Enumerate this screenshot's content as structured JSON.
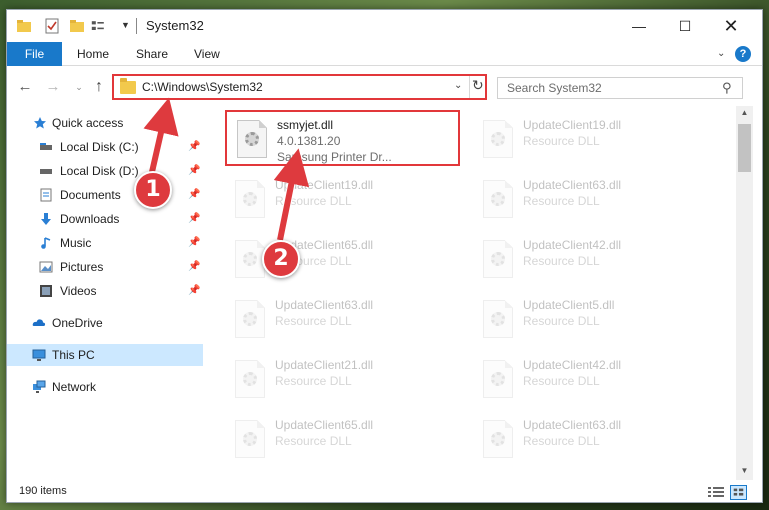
{
  "window": {
    "title": "System32",
    "min_glyph": "—",
    "max_glyph": "☐",
    "close_glyph": "✕"
  },
  "ribbon": {
    "tabs": [
      "File",
      "Home",
      "Share",
      "View"
    ],
    "help_glyph": "?",
    "chevron_glyph": "⌄"
  },
  "nav": {
    "back_glyph": "←",
    "forward_glyph": "→",
    "recent_glyph": "⌄",
    "up_glyph": "↑",
    "address": "C:\\Windows\\System32",
    "address_drop_glyph": "⌄",
    "refresh_glyph": "↻",
    "search_placeholder": "Search System32",
    "search_glyph": "⚲"
  },
  "sidebar": {
    "items": [
      {
        "label": "Quick access",
        "icon": "star-icon",
        "pinned": false
      },
      {
        "label": "Local Disk (C:)",
        "icon": "drive-icon",
        "pinned": true
      },
      {
        "label": "Local Disk (D:)",
        "icon": "drive-icon",
        "pinned": true
      },
      {
        "label": "Documents",
        "icon": "documents-icon",
        "pinned": true
      },
      {
        "label": "Downloads",
        "icon": "downloads-icon",
        "pinned": true
      },
      {
        "label": "Music",
        "icon": "music-icon",
        "pinned": true
      },
      {
        "label": "Pictures",
        "icon": "pictures-icon",
        "pinned": true
      },
      {
        "label": "Videos",
        "icon": "videos-icon",
        "pinned": true
      },
      {
        "label": "OneDrive",
        "icon": "onedrive-icon",
        "pinned": false
      },
      {
        "label": "This PC",
        "icon": "this-pc-icon",
        "pinned": false,
        "selected": true
      },
      {
        "label": "Network",
        "icon": "network-icon",
        "pinned": false
      }
    ],
    "pin_glyph": "📌"
  },
  "files": [
    {
      "name": "ssmyjet.dll",
      "line2": "4.0.1381.20",
      "line3": "Samsung Printer Dr..."
    },
    {
      "name": "UpdateClient19.dll",
      "line2": "Resource DLL"
    },
    {
      "name": "UpdateClient19.dll",
      "line2": "Resource DLL"
    },
    {
      "name": "UpdateClient63.dll",
      "line2": "Resource DLL"
    },
    {
      "name": "UpdateClient65.dll",
      "line2": "Resource DLL"
    },
    {
      "name": "UpdateClient42.dll",
      "line2": "Resource DLL"
    },
    {
      "name": "UpdateClient63.dll",
      "line2": "Resource DLL"
    },
    {
      "name": "UpdateClient5.dll",
      "line2": "Resource DLL"
    },
    {
      "name": "UpdateClient21.dll",
      "line2": "Resource DLL"
    },
    {
      "name": "UpdateClient42.dll",
      "line2": "Resource DLL"
    },
    {
      "name": "UpdateClient65.dll",
      "line2": "Resource DLL"
    },
    {
      "name": "UpdateClient63.dll",
      "line2": "Resource DLL"
    }
  ],
  "status": {
    "item_count": "190 items"
  },
  "callouts": [
    "1",
    "2"
  ],
  "colors": {
    "accent": "#1979ca",
    "highlight_red": "#e2373a",
    "selected_bg": "#cce8ff"
  }
}
